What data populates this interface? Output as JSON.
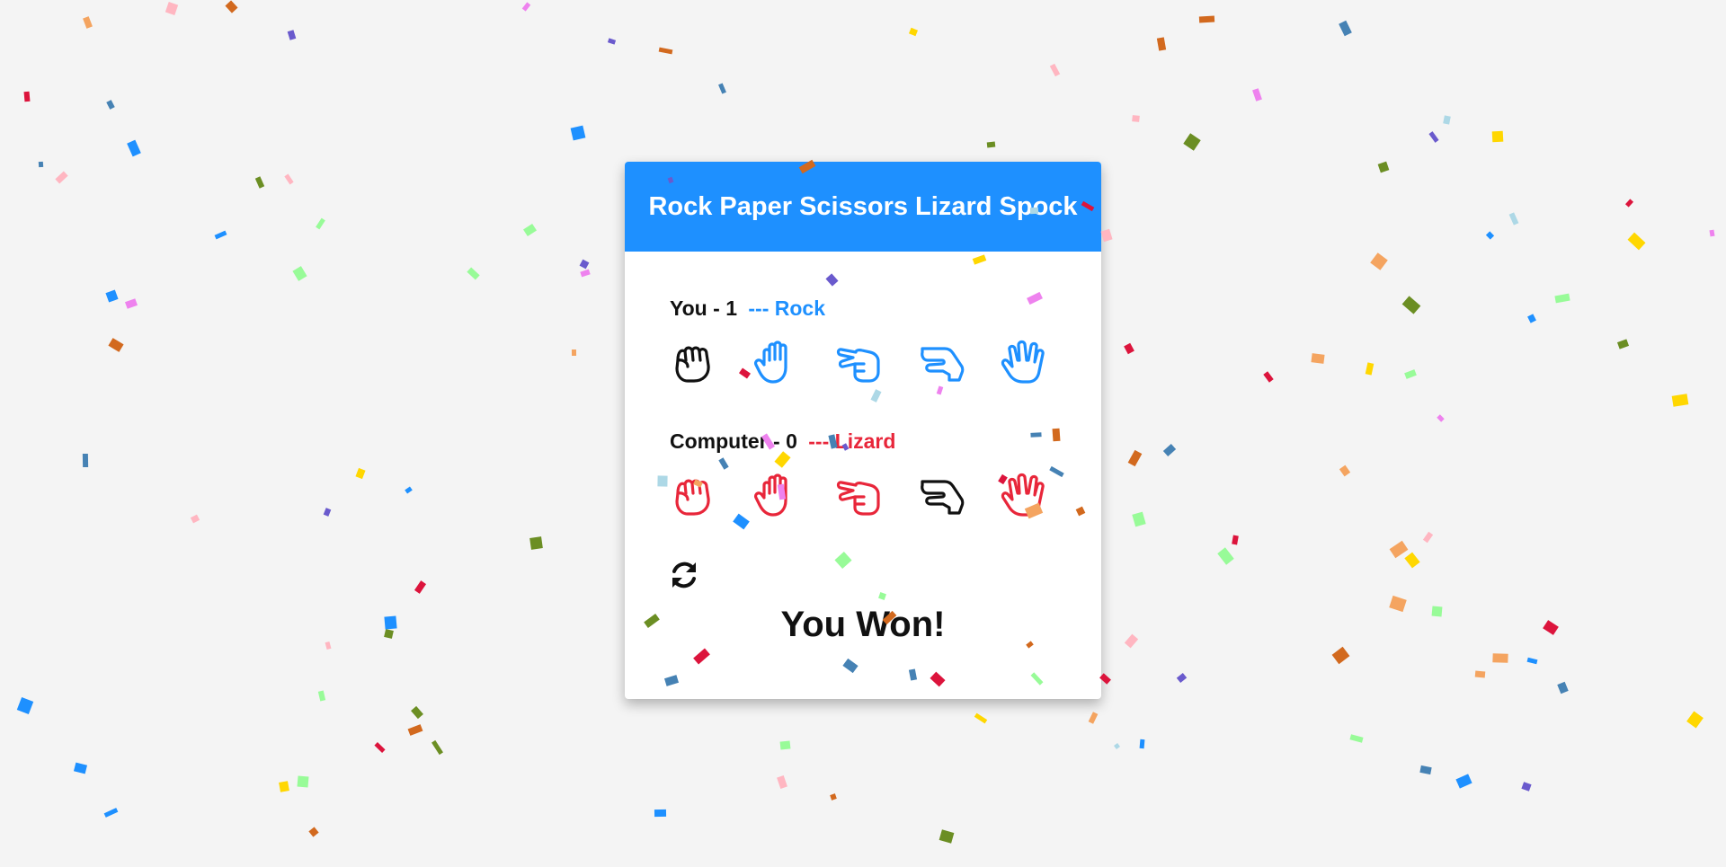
{
  "app": {
    "title": "Rock Paper Scissors Lizard Spock"
  },
  "player": {
    "label": "You",
    "score": "1",
    "separator": "---",
    "choice": "Rock",
    "color": "#1e90ff",
    "selected_index": 0
  },
  "computer": {
    "label": "Computer",
    "score": "0",
    "separator": "---",
    "choice": "Lizard",
    "color": "#e8263a",
    "selected_index": 3
  },
  "options": [
    {
      "name": "Rock",
      "icon": "hand-rock-icon"
    },
    {
      "name": "Paper",
      "icon": "hand-paper-icon"
    },
    {
      "name": "Scissors",
      "icon": "hand-scissors-icon"
    },
    {
      "name": "Lizard",
      "icon": "hand-lizard-icon"
    },
    {
      "name": "Spock",
      "icon": "hand-spock-icon"
    }
  ],
  "reset": {
    "icon": "refresh-icon"
  },
  "result": {
    "text": "You Won!"
  },
  "colors": {
    "header": "#1e90ff",
    "selected": "#111111",
    "background": "#f4f4f4",
    "confetti": [
      "#1e90ff",
      "#dc143c",
      "#d2691e",
      "#98fb98",
      "#ee82ee",
      "#6a5acd",
      "#add8e6",
      "#ffd700",
      "#6b8e23",
      "#ffb6c1",
      "#f4a460",
      "#4682b4"
    ]
  }
}
